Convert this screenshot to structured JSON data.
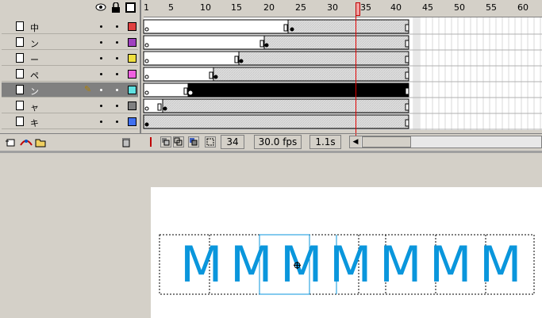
{
  "timeline": {
    "ruler_labels": [
      "1",
      "5",
      "10",
      "15",
      "20",
      "25",
      "30",
      "35",
      "40",
      "45",
      "50",
      "55",
      "60"
    ],
    "current_frame": "34",
    "fps": "30.0 fps",
    "elapsed": "1.1s"
  },
  "layers": [
    {
      "name": "中",
      "color": "#e04040"
    },
    {
      "name": "ン",
      "color": "#a040c0"
    },
    {
      "name": "ー",
      "color": "#f0e040"
    },
    {
      "name": "ペ",
      "color": "#f060e0"
    },
    {
      "name": "ン",
      "color": "#60e0e0",
      "selected": true
    },
    {
      "name": "ャ",
      "color": "#808080"
    },
    {
      "name": "キ",
      "color": "#4070f0"
    }
  ],
  "stage": {
    "letters": [
      "M",
      "M",
      "M",
      "M",
      "M",
      "M",
      "M"
    ]
  }
}
